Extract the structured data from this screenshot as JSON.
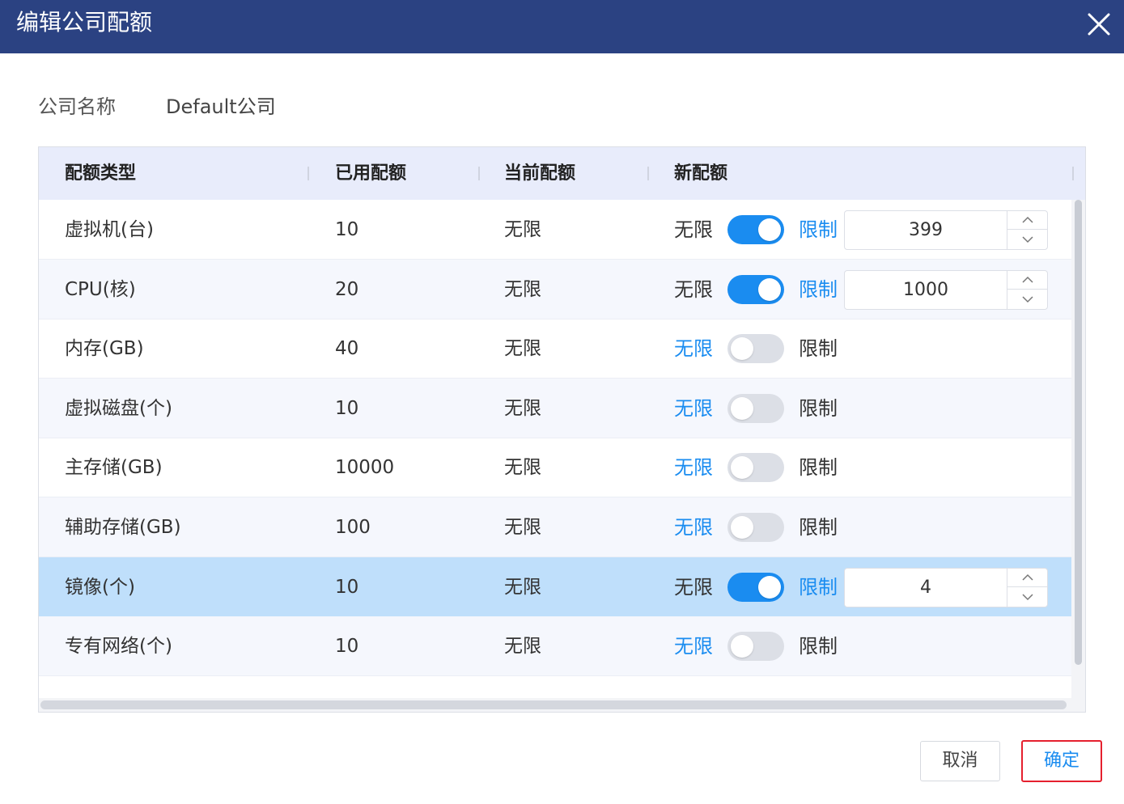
{
  "dialog": {
    "title": "编辑公司配额"
  },
  "company": {
    "label": "公司名称",
    "value": "Default公司"
  },
  "table": {
    "headers": [
      "配额类型",
      "已用配额",
      "当前配额",
      "新配额"
    ],
    "rows": [
      {
        "type": "虚拟机(台)",
        "used": "10",
        "current": "无限",
        "unlimited_label": "无限",
        "limit_label": "限制",
        "limited": true,
        "value": "399"
      },
      {
        "type": "CPU(核)",
        "used": "20",
        "current": "无限",
        "unlimited_label": "无限",
        "limit_label": "限制",
        "limited": true,
        "value": "1000"
      },
      {
        "type": "内存(GB)",
        "used": "40",
        "current": "无限",
        "unlimited_label": "无限",
        "limit_label": "限制",
        "limited": false
      },
      {
        "type": "虚拟磁盘(个)",
        "used": "10",
        "current": "无限",
        "unlimited_label": "无限",
        "limit_label": "限制",
        "limited": false
      },
      {
        "type": "主存储(GB)",
        "used": "10000",
        "current": "无限",
        "unlimited_label": "无限",
        "limit_label": "限制",
        "limited": false
      },
      {
        "type": "辅助存储(GB)",
        "used": "100",
        "current": "无限",
        "unlimited_label": "无限",
        "limit_label": "限制",
        "limited": false
      },
      {
        "type": "镜像(个)",
        "used": "10",
        "current": "无限",
        "unlimited_label": "无限",
        "limit_label": "限制",
        "limited": true,
        "value": "4"
      },
      {
        "type": "专有网络(个)",
        "used": "10",
        "current": "无限",
        "unlimited_label": "无限",
        "limit_label": "限制",
        "limited": false
      }
    ]
  },
  "footer": {
    "cancel_label": "取消",
    "confirm_label": "确定"
  },
  "colors": {
    "header_bg": "#2b4282",
    "accent": "#1a8cf0",
    "selected_row": "#bfdffb",
    "highlight_border": "#e5202e"
  }
}
